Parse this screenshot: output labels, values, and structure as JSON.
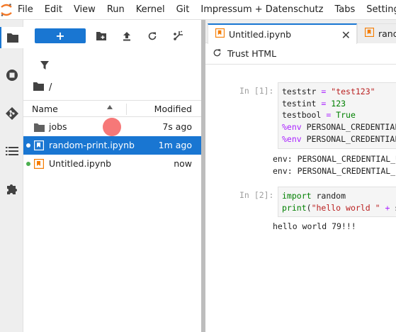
{
  "menubar": {
    "items": [
      "File",
      "Edit",
      "View",
      "Run",
      "Kernel",
      "Git",
      "Impressum + Datenschutz",
      "Tabs",
      "Settings"
    ]
  },
  "activity_bar": {
    "items": [
      "folder-icon",
      "running-icon",
      "git-icon",
      "toc-icon",
      "extensions-icon"
    ]
  },
  "file_browser": {
    "new_label": "+",
    "breadcrumb_root": "/",
    "columns": {
      "name": "Name",
      "modified": "Modified"
    },
    "rows": [
      {
        "name": "jobs",
        "modified": "7s ago",
        "type": "folder",
        "running": false,
        "selected": false
      },
      {
        "name": "random-print.ipynb",
        "modified": "1m ago",
        "type": "notebook",
        "running": true,
        "selected": true
      },
      {
        "name": "Untitled.ipynb",
        "modified": "now",
        "type": "notebook",
        "running": true,
        "selected": false
      }
    ]
  },
  "tabs": [
    {
      "label": "Untitled.ipynb",
      "active": true
    },
    {
      "label": "rando",
      "active": false
    }
  ],
  "notebook_toolbar": {
    "trust_label": "Trust HTML"
  },
  "cells": [
    {
      "prompt": "In [1]:",
      "lines": [
        "teststr = \"test123\"",
        "testint = 123",
        "testbool = True",
        "%env PERSONAL_CREDENTIAL_",
        "%env PERSONAL_CREDENTIAL_"
      ],
      "output": [
        "env: PERSONAL_CREDENTIAL_US",
        "env: PERSONAL_CREDENTIAL_PA"
      ]
    },
    {
      "prompt": "In [2]:",
      "lines": [
        "import random",
        "print(\"hello world \" + st"
      ],
      "output": [
        "hello world 79!!!"
      ]
    }
  ],
  "colors": {
    "accent": "#1976d2",
    "notebook_icon": "#f57c00",
    "running_dot": "#4caf50"
  }
}
